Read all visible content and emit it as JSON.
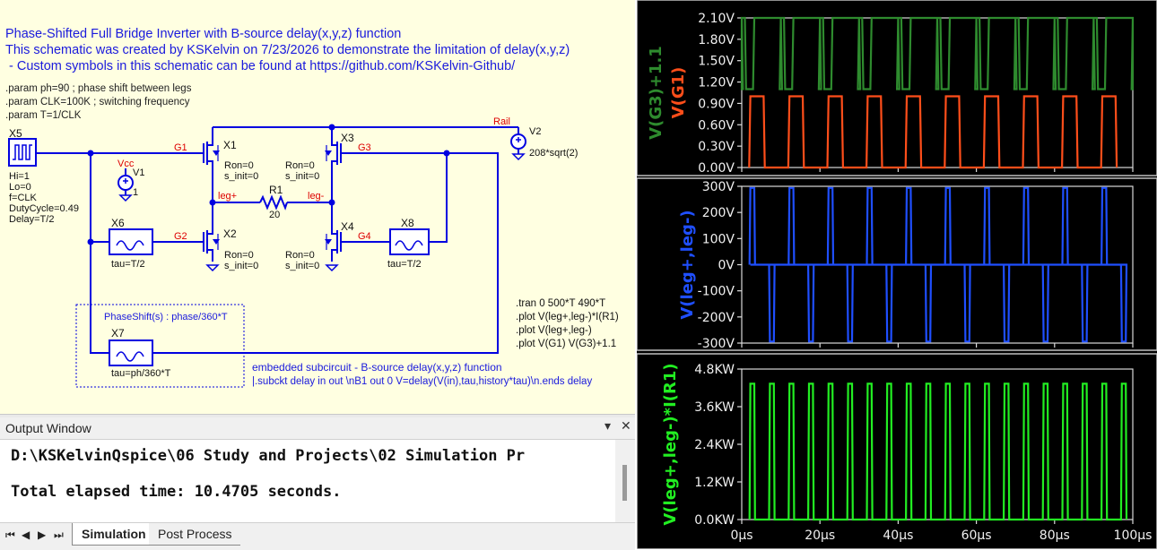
{
  "schematic": {
    "title": "Phase-Shifted Full Bridge Inverter with B-source delay(x,y,z) function",
    "desc1": "This schematic was created by KSKelvin on 7/23/2026 to demonstrate the limitation of delay(x,y,z)",
    "desc2": " - Custom symbols in this schematic can be found at https://github.com/KSKelvin-Github/",
    "params": [
      ".param ph=90 ; phase shift between legs",
      ".param CLK=100K ; switching frequency",
      ".param T=1/CLK"
    ],
    "sim_cmds": [
      ".tran 0 500*T 490*T",
      ".plot V(leg+,leg-)*I(R1)",
      ".plot V(leg+,leg-)",
      ".plot V(G1) V(G3)+1.1"
    ],
    "embedded_title": "embedded subcircuit - B-source delay(x,y,z) function",
    "embedded_code": "|.subckt delay in out \\nB1 out 0 V=delay(V(in),tau,history*tau)\\n.ends delay",
    "x5": {
      "name": "X5",
      "attrs": [
        "Hi=1",
        "Lo=0",
        "f=CLK",
        "DutyCycle=0.49",
        "Delay=T/2"
      ]
    },
    "x6": {
      "name": "X6",
      "tau": "tau=T/2"
    },
    "x7": {
      "name": "X7",
      "tau": "tau=ph/360*T",
      "param": "PhaseShift(s) : phase/360*T"
    },
    "x8": {
      "name": "X8",
      "tau": "tau=T/2"
    },
    "v1": {
      "name": "V1",
      "value": "1",
      "net": "Vcc"
    },
    "v2": {
      "name": "V2",
      "value": "208*sqrt(2)",
      "net": "Rail"
    },
    "r1": {
      "name": "R1",
      "value": "20"
    },
    "mosfets": [
      {
        "name": "X1",
        "ron": "Ron=0",
        "sinit": "s_init=0"
      },
      {
        "name": "X2",
        "ron": "Ron=0",
        "sinit": "s_init=0"
      },
      {
        "name": "X3",
        "ron": "Ron=0",
        "sinit": "s_init=0"
      },
      {
        "name": "X4",
        "ron": "Ron=0",
        "sinit": "s_init=0"
      }
    ],
    "nets": {
      "g1": "G1",
      "g2": "G2",
      "g3": "G3",
      "g4": "G4",
      "legp": "leg+",
      "legm": "leg-"
    }
  },
  "output_window": {
    "title": "Output Window",
    "lines": [
      "D:\\KSKelvinQspice\\06 Study and Projects\\02 Simulation Pr",
      "Total elapsed time: 10.4705 seconds."
    ],
    "tabs": [
      "Simulation",
      "Post Process"
    ],
    "active_tab": "Simulation"
  },
  "colors": {
    "green_dark": "#2e8b2e",
    "orange": "#ff4e1a",
    "blue": "#1f4fff",
    "green_bright": "#22ee22"
  },
  "chart_data": [
    {
      "type": "line",
      "title": "",
      "ylabels": [
        "V(G3)+1.1",
        "V(G1)"
      ],
      "yticks": [
        "2.10V",
        "1.80V",
        "1.50V",
        "1.20V",
        "0.90V",
        "0.60V",
        "0.30V",
        "0.00V"
      ],
      "ylim": [
        0,
        2.1
      ],
      "xlim": [
        0,
        100
      ],
      "grid": false,
      "series": [
        {
          "name": "V(G3)+1.1",
          "period_us": 10,
          "rise_us": 0.3,
          "low": 1.1,
          "high": 2.1,
          "high_segments": [
            [
              0,
              0.8
            ],
            [
              3.2,
              10.0
            ]
          ]
        },
        {
          "name": "V(G1)",
          "period_us": 10,
          "rise_us": 0.3,
          "low": 0,
          "high": 1.0,
          "high_segments": [
            [
              2.2,
              5.6
            ]
          ]
        }
      ]
    },
    {
      "type": "line",
      "title": "",
      "ylabels": [
        "V(leg+,leg-)"
      ],
      "yticks": [
        "300V",
        "200V",
        "100V",
        "0V",
        "-100V",
        "-200V",
        "-300V"
      ],
      "ylim": [
        -300,
        300
      ],
      "xlim": [
        0,
        100
      ],
      "grid": false,
      "series": [
        {
          "name": "V(leg+,leg-)",
          "period_us": 10,
          "amplitude": 294,
          "pos_segments": [
            [
              2.2,
              3.2
            ]
          ],
          "neg_segments": [
            [
              7.2,
              8.2
            ]
          ]
        }
      ]
    },
    {
      "type": "line",
      "title": "",
      "ylabels": [
        "V(leg+,leg-)*I(R1)"
      ],
      "yticks": [
        "4.8KW",
        "3.6KW",
        "2.4KW",
        "1.2KW",
        "0.0KW"
      ],
      "ylim": [
        0,
        4.8
      ],
      "xlim": [
        0,
        100
      ],
      "xticks": [
        "0µs",
        "20µs",
        "40µs",
        "60µs",
        "80µs",
        "100µs"
      ],
      "grid": false,
      "series": [
        {
          "name": "V(leg+,leg-)*I(R1)",
          "period_us": 5,
          "high": 4.33,
          "high_segments": [
            [
              2.2,
              3.2
            ]
          ]
        }
      ]
    }
  ]
}
